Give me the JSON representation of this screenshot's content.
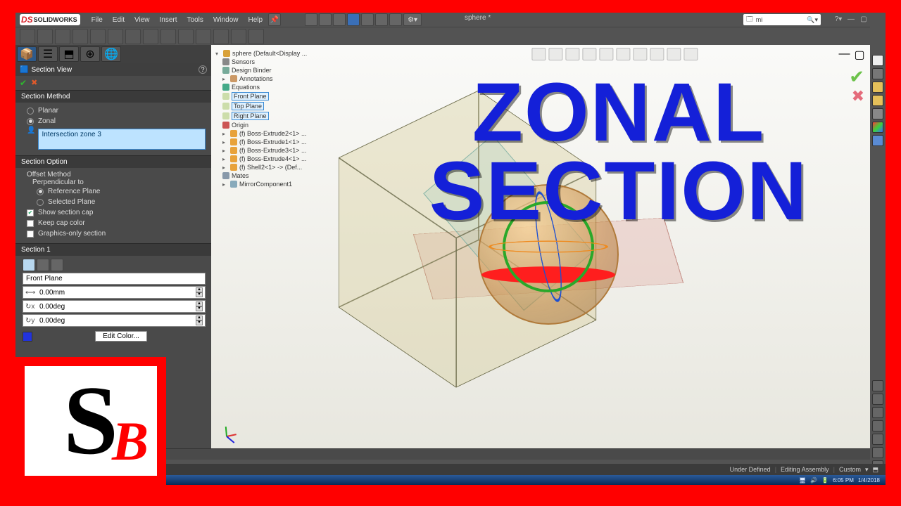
{
  "app": {
    "brand": "SOLIDWORKS",
    "document_title": "sphere *"
  },
  "menu": [
    "File",
    "Edit",
    "View",
    "Insert",
    "Tools",
    "Window",
    "Help"
  ],
  "search_placeholder": "mi",
  "section_view": {
    "title": "Section View",
    "method_header": "Section Method",
    "method": {
      "planar": "Planar",
      "zonal": "Zonal",
      "selected": "Zonal",
      "selection_value": "Intersection zone 3"
    },
    "option_header": "Section Option",
    "option": {
      "offset_label": "Offset Method",
      "perp_label": "Perpendicular to",
      "ref_plane": "Reference Plane",
      "sel_plane": "Selected Plane",
      "offset_selected": "Reference Plane"
    },
    "checks": {
      "show_cap": {
        "label": "Show section cap",
        "value": true
      },
      "keep_cap_color": {
        "label": "Keep cap color",
        "value": false
      },
      "graphics_only": {
        "label": "Graphics-only section",
        "value": false
      }
    },
    "section1": {
      "header": "Section 1",
      "plane": "Front Plane",
      "offset": "0.00mm",
      "angle1": "0.00deg",
      "angle2": "0.00deg",
      "edit_color": "Edit Color..."
    }
  },
  "tree": {
    "root": "sphere  (Default<Display ...",
    "items": [
      {
        "label": "Sensors",
        "icon": "sensor"
      },
      {
        "label": "Design Binder",
        "icon": "binder"
      },
      {
        "label": "Annotations",
        "icon": "annot",
        "expand": true
      },
      {
        "label": "Equations",
        "icon": "eq"
      },
      {
        "label": "Front Plane",
        "icon": "plane",
        "hl": true
      },
      {
        "label": "Top Plane",
        "icon": "plane",
        "hl": true
      },
      {
        "label": "Right Plane",
        "icon": "plane",
        "hl": true
      },
      {
        "label": "Origin",
        "icon": "origin"
      },
      {
        "label": "(f) Boss-Extrude2<1> ...",
        "icon": "part",
        "expand": true
      },
      {
        "label": "(f) Boss-Extrude1<1> ...",
        "icon": "part",
        "expand": true
      },
      {
        "label": "(f) Boss-Extrude3<1> ...",
        "icon": "part",
        "expand": true
      },
      {
        "label": "(f) Boss-Extrude4<1> ...",
        "icon": "part",
        "expand": true
      },
      {
        "label": "(f) Shell2<1> -> (Def...",
        "icon": "part",
        "expand": true
      },
      {
        "label": "Mates",
        "icon": "mates"
      },
      {
        "label": "MirrorComponent1",
        "icon": "mirror",
        "expand": true
      }
    ]
  },
  "overlay_title": {
    "line1": "ZONAL",
    "line2": "SECTION"
  },
  "status": {
    "def": "Under Defined",
    "mode": "Editing Assembly",
    "units": "Custom"
  },
  "taskbar": {
    "time": "6:05 PM",
    "date": "1/4/2018"
  }
}
